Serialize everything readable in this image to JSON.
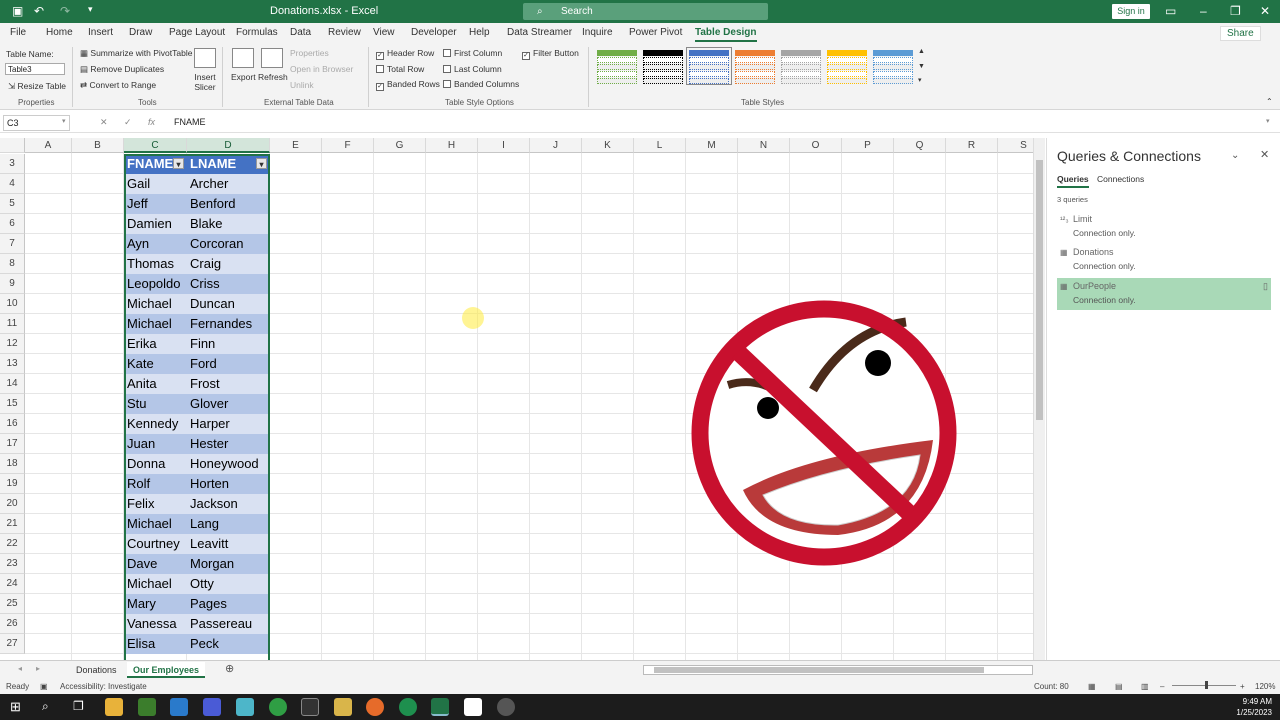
{
  "window": {
    "title": "Donations.xlsx  -  Excel",
    "search_placeholder": "Search",
    "signin": "Sign in",
    "share": "Share"
  },
  "menu": [
    "File",
    "Home",
    "Insert",
    "Draw",
    "Page Layout",
    "Formulas",
    "Data",
    "Review",
    "View",
    "Developer",
    "Help",
    "Data Streamer",
    "Inquire",
    "Power Pivot",
    "Table Design"
  ],
  "active_menu": "Table Design",
  "ribbon": {
    "properties": {
      "table_name_label": "Table Name:",
      "table_name_value": "Table3",
      "resize_table": "Resize Table",
      "group": "Properties"
    },
    "tools": {
      "summarize": "Summarize with PivotTable",
      "remove_duplicates": "Remove Duplicates",
      "convert_to_range": "Convert to Range",
      "insert_slicer": "Insert Slicer",
      "group": "Tools"
    },
    "external": {
      "export": "Export",
      "refresh": "Refresh",
      "properties": "Properties",
      "open_in_browser": "Open in Browser",
      "unlink": "Unlink",
      "group": "External Table Data"
    },
    "style_options": {
      "header_row": "Header Row",
      "total_row": "Total Row",
      "banded_rows": "Banded Rows",
      "first_column": "First Column",
      "last_column": "Last Column",
      "banded_columns": "Banded Columns",
      "filter_button": "Filter Button",
      "group": "Table Style Options"
    },
    "styles": {
      "group": "Table Styles",
      "swatch_colors": [
        "#70ad47",
        "#000000",
        "#4472c4",
        "#ed7d31",
        "#a5a5a5",
        "#ffc000",
        "#5b9bd5"
      ]
    }
  },
  "formula_bar": {
    "cell_ref": "C3",
    "content": "FNAME"
  },
  "columns": [
    "A",
    "B",
    "C",
    "D",
    "E",
    "F",
    "G",
    "H",
    "I",
    "J",
    "K",
    "L",
    "M",
    "N",
    "O",
    "P",
    "Q",
    "R",
    "S"
  ],
  "rows": [
    "3",
    "4",
    "5",
    "6",
    "7",
    "8",
    "9",
    "10",
    "11",
    "12",
    "13",
    "14",
    "15",
    "16",
    "17",
    "18",
    "19",
    "20",
    "21",
    "22",
    "23",
    "24",
    "25",
    "26",
    "27"
  ],
  "table": {
    "headers": [
      "FNAME",
      "LNAME"
    ],
    "records": [
      [
        "Gail",
        "Archer"
      ],
      [
        "Jeff",
        "Benford"
      ],
      [
        "Damien",
        "Blake"
      ],
      [
        "Ayn",
        "Corcoran"
      ],
      [
        "Thomas",
        "Craig"
      ],
      [
        "Leopoldo",
        "Criss"
      ],
      [
        "Michael",
        "Duncan"
      ],
      [
        "Michael",
        "Fernandes"
      ],
      [
        "Erika",
        "Finn"
      ],
      [
        "Kate",
        "Ford"
      ],
      [
        "Anita",
        "Frost"
      ],
      [
        "Stu",
        "Glover"
      ],
      [
        "Kennedy",
        "Harper"
      ],
      [
        "Juan",
        "Hester"
      ],
      [
        "Donna",
        "Honeywood"
      ],
      [
        "Rolf",
        "Horten"
      ],
      [
        "Felix",
        "Jackson"
      ],
      [
        "Michael",
        "Lang"
      ],
      [
        "Courtney",
        "Leavitt"
      ],
      [
        "Dave",
        "Morgan"
      ],
      [
        "Michael",
        "Otty"
      ],
      [
        "Mary",
        "Pages"
      ],
      [
        "Vanessa",
        "Passereau"
      ],
      [
        "Elisa",
        "Peck"
      ]
    ]
  },
  "pane": {
    "title": "Queries & Connections",
    "tabs": [
      "Queries",
      "Connections"
    ],
    "count": "3 queries",
    "items": [
      {
        "name": "Limit",
        "status": "Connection only.",
        "icon": "123-icon"
      },
      {
        "name": "Donations",
        "status": "Connection only.",
        "icon": "table-icon"
      },
      {
        "name": "OurPeople",
        "status": "Connection only.",
        "icon": "table-icon"
      }
    ],
    "selected": "OurPeople"
  },
  "sheets": [
    "Donations",
    "Our Employees"
  ],
  "active_sheet": "Our Employees",
  "status": {
    "ready": "Ready",
    "accessibility": "Accessibility: Investigate",
    "count": "Count: 80",
    "zoom": "120%"
  },
  "clock": {
    "time": "9:49 AM",
    "date": "1/25/2023"
  }
}
